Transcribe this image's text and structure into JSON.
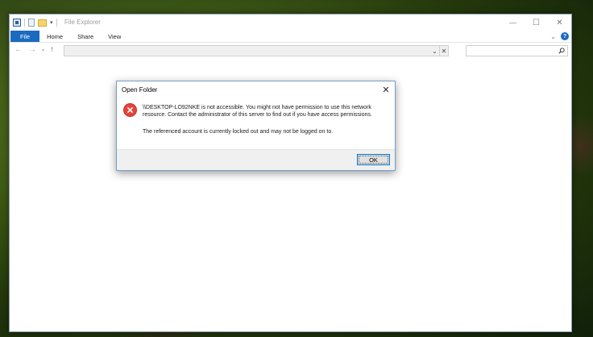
{
  "explorer": {
    "title": "File Explorer",
    "ribbon_tabs": [
      "File",
      "Home",
      "Share",
      "View"
    ],
    "address_value": "",
    "search_placeholder": ""
  },
  "dialog": {
    "title": "Open Folder",
    "message": "\\\\DESKTOP-LO92NKE is not accessible. You might not have permission to use this network resource. Contact the administrator of this server to find out if you have access permissions.",
    "detail": "The referenced account is currently locked out and may not be logged on to.",
    "ok_label": "OK"
  },
  "icons": {
    "error": "error-icon",
    "close": "close-icon",
    "search": "search-icon",
    "help": "help-icon"
  },
  "colors": {
    "accent": "#1a6ac0",
    "error": "#e8423a",
    "ok_border": "#0078d7"
  }
}
